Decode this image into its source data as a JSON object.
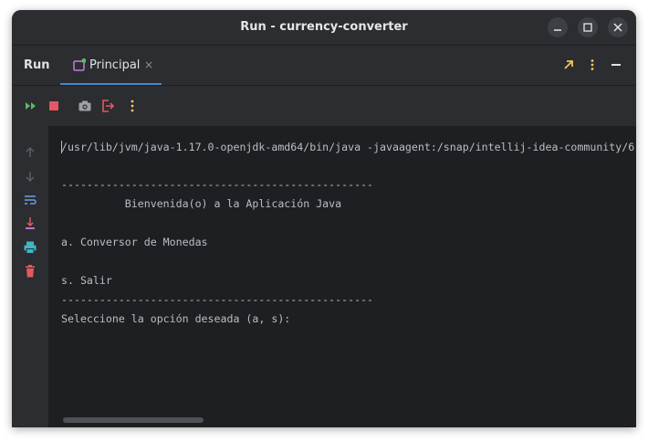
{
  "window": {
    "title": "Run - currency-converter"
  },
  "tool_window": {
    "label": "Run",
    "tab": {
      "label": "Principal",
      "close": "×"
    }
  },
  "console": {
    "command": "/usr/lib/jvm/java-1.17.0-openjdk-amd64/bin/java -javaagent:/snap/intellij-idea-community/6",
    "lines": [
      "-------------------------------------------------",
      "          Bienvenida(o) a la Aplicación Java",
      "a. Conversor de Monedas",
      "s. Salir",
      "-------------------------------------------------",
      "Seleccione la opción deseada (a, s):"
    ]
  },
  "colors": {
    "background": "#2b2d30",
    "console_bg": "#1e1f22",
    "accent_tab_underline": "#4a88c7",
    "stop_red": "#e55765",
    "rerun_green": "#5fb865",
    "more_yellow": "#f2c55c"
  }
}
